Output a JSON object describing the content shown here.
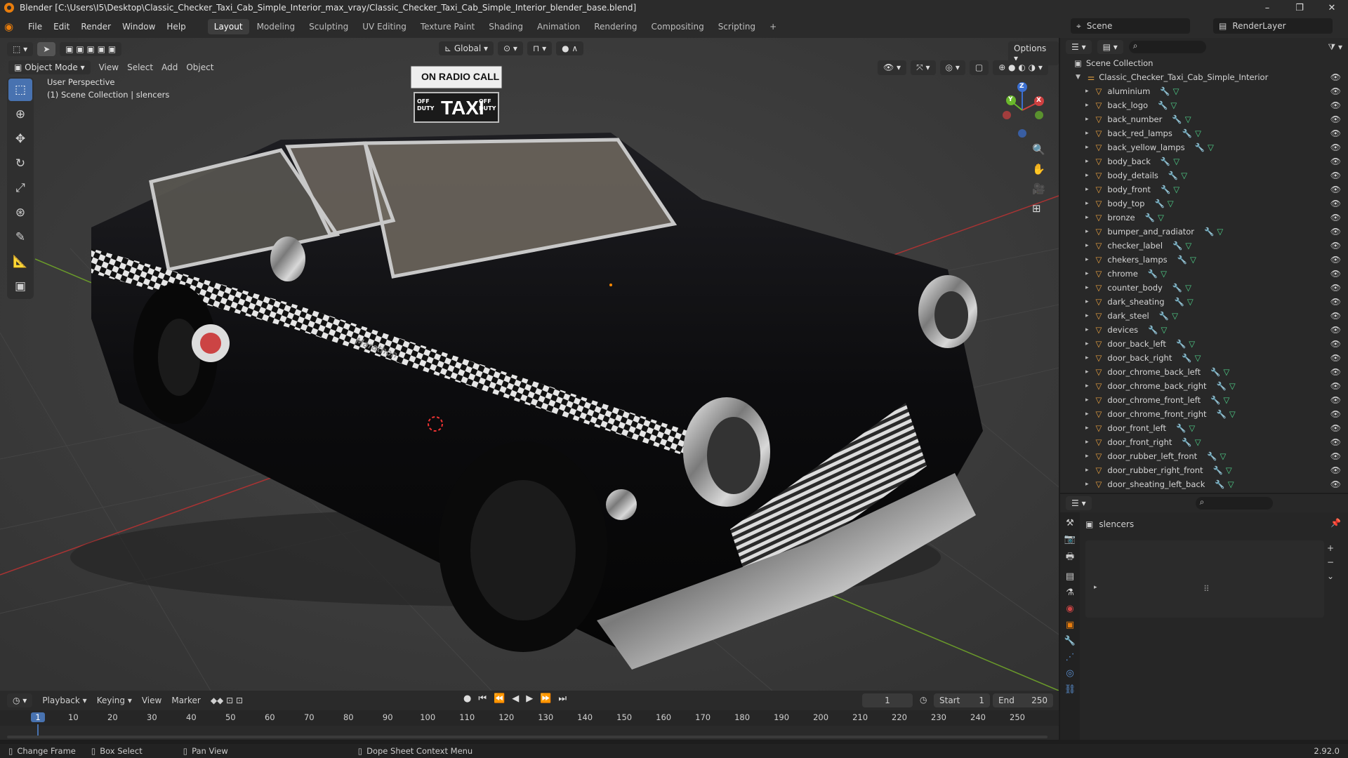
{
  "window": {
    "title": "Blender [C:\\Users\\I5\\Desktop\\Classic_Checker_Taxi_Cab_Simple_Interior_max_vray/Classic_Checker_Taxi_Cab_Simple_Interior_blender_base.blend]",
    "minimize": "–",
    "maximize": "❐",
    "close": "✕"
  },
  "menu": [
    "File",
    "Edit",
    "Render",
    "Window",
    "Help"
  ],
  "workspaces": [
    "Layout",
    "Modeling",
    "Sculpting",
    "UV Editing",
    "Texture Paint",
    "Shading",
    "Animation",
    "Rendering",
    "Compositing",
    "Scripting"
  ],
  "active_workspace": "Layout",
  "add_workspace": "+",
  "scene": {
    "label": "Scene",
    "render_layer": "RenderLayer"
  },
  "viewport": {
    "mode": "Object Mode",
    "menus": [
      "View",
      "Select",
      "Add",
      "Object"
    ],
    "orientation": "Global",
    "options": "Options",
    "perspective": "User Perspective",
    "collection_info": "(1) Scene Collection | slencers",
    "gizmo_axes": {
      "x": "X",
      "y": "Y",
      "z": "Z"
    },
    "taxi_sign_top": "ON RADIO CALL",
    "taxi_sign_main": "TAXI",
    "taxi_sign_left": "OFF DUTY",
    "taxi_sign_right": "OFF DUTY",
    "car_script": "Marathon"
  },
  "outliner": {
    "root": "Scene Collection",
    "collection": "Classic_Checker_Taxi_Cab_Simple_Interior",
    "objects": [
      "aluminium",
      "back_logo",
      "back_number",
      "back_red_lamps",
      "back_yellow_lamps",
      "body_back",
      "body_details",
      "body_front",
      "body_top",
      "bronze",
      "bumper_and_radiator",
      "checker_label",
      "chekers_lamps",
      "chrome",
      "counter_body",
      "dark_sheating",
      "dark_steel",
      "devices",
      "door_back_left",
      "door_back_right",
      "door_chrome_back_left",
      "door_chrome_back_right",
      "door_chrome_front_left",
      "door_chrome_front_right",
      "door_front_left",
      "door_front_right",
      "door_rubber_left_front",
      "door_rubber_right_front",
      "door_sheating_left_back"
    ]
  },
  "properties": {
    "object_name": "slencers"
  },
  "timeline": {
    "menus": [
      "Playback",
      "Keying",
      "View",
      "Marker"
    ],
    "current_frame": "1",
    "start_label": "Start",
    "start": "1",
    "end_label": "End",
    "end": "250",
    "ticks": [
      "1",
      "10",
      "20",
      "30",
      "40",
      "50",
      "60",
      "70",
      "80",
      "90",
      "100",
      "110",
      "120",
      "130",
      "140",
      "150",
      "160",
      "170",
      "180",
      "190",
      "200",
      "210",
      "220",
      "230",
      "240",
      "250"
    ]
  },
  "status": {
    "change_frame": "Change Frame",
    "box_select": "Box Select",
    "pan_view": "Pan View",
    "context_menu": "Dope Sheet Context Menu",
    "version": "2.92.0"
  }
}
